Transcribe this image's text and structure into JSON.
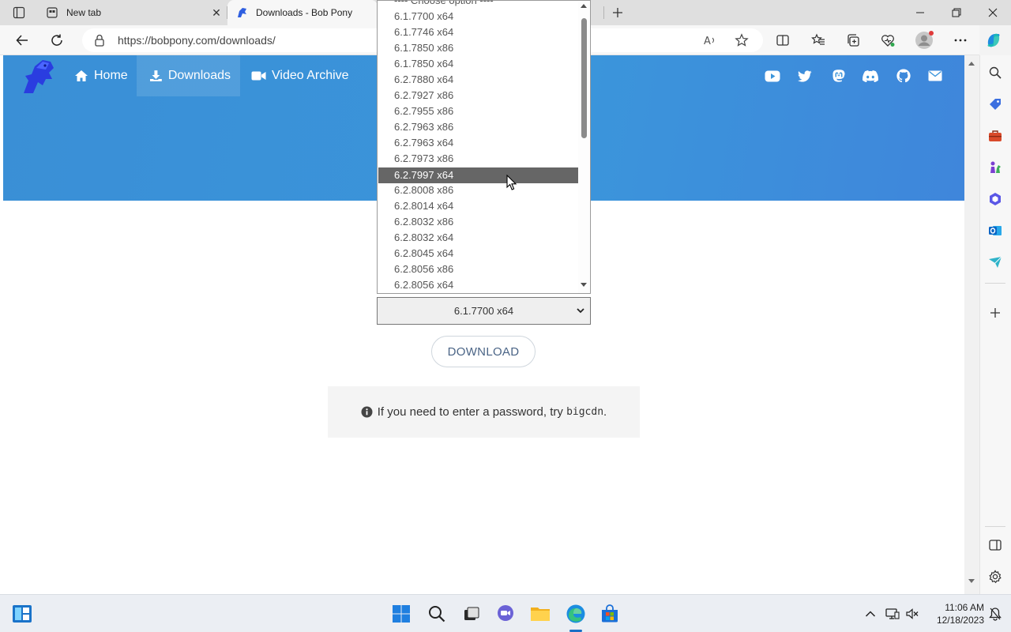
{
  "browser": {
    "tabs": [
      {
        "title": "New tab",
        "active": false
      },
      {
        "title": "Downloads - Bob Pony",
        "active": true
      }
    ],
    "url": "https://bobpony.com/downloads/"
  },
  "nav": {
    "items": [
      {
        "label": "Home"
      },
      {
        "label": "Downloads"
      },
      {
        "label": "Video Archive"
      }
    ],
    "social_icons": [
      "youtube-icon",
      "twitter-icon",
      "mastodon-icon",
      "discord-icon",
      "github-icon",
      "mail-icon"
    ]
  },
  "select": {
    "value": "6.1.7700 x64",
    "options": [
      "---- Choose option ----",
      "6.1.7700 x64",
      "6.1.7746 x64",
      "6.1.7850 x86",
      "6.1.7850 x64",
      "6.2.7880 x64",
      "6.2.7927 x86",
      "6.2.7955 x86",
      "6.2.7963 x86",
      "6.2.7963 x64",
      "6.2.7973 x86",
      "6.2.7997 x64",
      "6.2.8008 x86",
      "6.2.8014 x64",
      "6.2.8032 x86",
      "6.2.8032 x64",
      "6.2.8045 x64",
      "6.2.8056 x86",
      "6.2.8056 x64"
    ],
    "highlighted": "6.2.7997 x64"
  },
  "download_label": "DOWNLOAD",
  "notice": {
    "prefix": "If you need to enter a password, try",
    "code": "bigcdn",
    "suffix": "."
  },
  "taskbar": {
    "time": "11:06 AM",
    "date": "12/18/2023"
  },
  "colors": {
    "hero": "#3b95db",
    "highlight": "#666666"
  }
}
